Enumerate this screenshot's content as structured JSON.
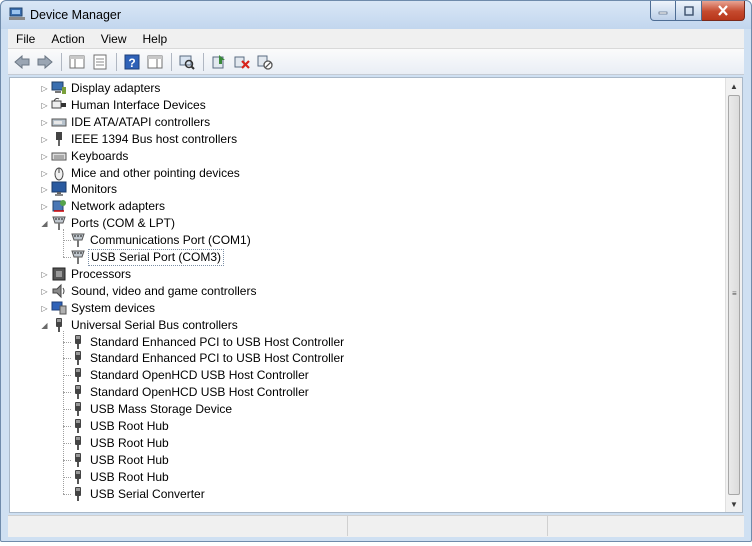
{
  "window": {
    "title": "Device Manager"
  },
  "menu": [
    "File",
    "Action",
    "View",
    "Help"
  ],
  "toolbar": {
    "buttons": [
      "back-icon",
      "forward-icon",
      "show-hide-console-tree-icon",
      "properties-icon",
      "help-icon",
      "toggle-action-pane-icon",
      "scan-hardware-icon",
      "update-driver-icon",
      "uninstall-icon",
      "disable-device-icon"
    ]
  },
  "tree": [
    {
      "label": "Display adapters",
      "level": 0,
      "expander": "collapsed",
      "icon": "display-adapter-icon"
    },
    {
      "label": "Human Interface Devices",
      "level": 0,
      "expander": "collapsed",
      "icon": "hid-icon"
    },
    {
      "label": "IDE ATA/ATAPI controllers",
      "level": 0,
      "expander": "collapsed",
      "icon": "ide-controller-icon"
    },
    {
      "label": "IEEE 1394 Bus host controllers",
      "level": 0,
      "expander": "collapsed",
      "icon": "ieee1394-icon"
    },
    {
      "label": "Keyboards",
      "level": 0,
      "expander": "collapsed",
      "icon": "keyboard-icon"
    },
    {
      "label": "Mice and other pointing devices",
      "level": 0,
      "expander": "collapsed",
      "icon": "mouse-icon"
    },
    {
      "label": "Monitors",
      "level": 0,
      "expander": "collapsed",
      "icon": "monitor-icon"
    },
    {
      "label": "Network adapters",
      "level": 0,
      "expander": "collapsed",
      "icon": "network-adapter-icon"
    },
    {
      "label": "Ports (COM & LPT)",
      "level": 0,
      "expander": "expanded",
      "icon": "port-icon"
    },
    {
      "label": "Communications Port (COM1)",
      "level": 1,
      "icon": "port-icon"
    },
    {
      "label": "USB Serial Port (COM3)",
      "level": 1,
      "icon": "port-icon",
      "selected": true
    },
    {
      "label": "Processors",
      "level": 0,
      "expander": "collapsed",
      "icon": "processor-icon"
    },
    {
      "label": "Sound, video and game controllers",
      "level": 0,
      "expander": "collapsed",
      "icon": "sound-icon"
    },
    {
      "label": "System devices",
      "level": 0,
      "expander": "collapsed",
      "icon": "system-device-icon"
    },
    {
      "label": "Universal Serial Bus controllers",
      "level": 0,
      "expander": "expanded",
      "icon": "usb-icon"
    },
    {
      "label": "Standard Enhanced PCI to USB Host Controller",
      "level": 1,
      "icon": "usb-icon"
    },
    {
      "label": "Standard Enhanced PCI to USB Host Controller",
      "level": 1,
      "icon": "usb-icon"
    },
    {
      "label": "Standard OpenHCD USB Host Controller",
      "level": 1,
      "icon": "usb-icon"
    },
    {
      "label": "Standard OpenHCD USB Host Controller",
      "level": 1,
      "icon": "usb-icon"
    },
    {
      "label": "USB Mass Storage Device",
      "level": 1,
      "icon": "usb-icon"
    },
    {
      "label": "USB Root Hub",
      "level": 1,
      "icon": "usb-icon"
    },
    {
      "label": "USB Root Hub",
      "level": 1,
      "icon": "usb-icon"
    },
    {
      "label": "USB Root Hub",
      "level": 1,
      "icon": "usb-icon"
    },
    {
      "label": "USB Root Hub",
      "level": 1,
      "icon": "usb-icon"
    },
    {
      "label": "USB Serial Converter",
      "level": 1,
      "icon": "usb-icon"
    }
  ],
  "colors": {
    "titlebar": "#c9dbf0",
    "close_button": "#c54a2e",
    "selection_border": "#7c8fa6"
  }
}
